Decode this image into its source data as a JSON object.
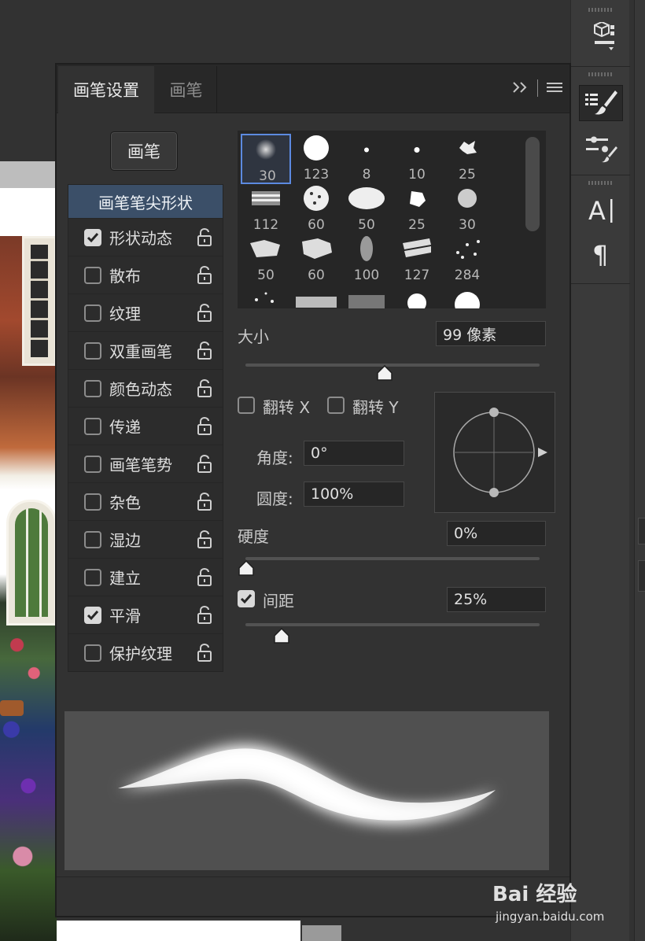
{
  "panel": {
    "tabs": [
      {
        "label": "画笔设置"
      },
      {
        "label": "画笔"
      }
    ],
    "brush_button_label": "画笔"
  },
  "settings_list": {
    "header": "画笔笔尖形状",
    "items": [
      {
        "label": "形状动态",
        "checked": true
      },
      {
        "label": "散布",
        "checked": false
      },
      {
        "label": "纹理",
        "checked": false
      },
      {
        "label": "双重画笔",
        "checked": false
      },
      {
        "label": "颜色动态",
        "checked": false
      },
      {
        "label": "传递",
        "checked": false
      },
      {
        "label": "画笔笔势",
        "checked": false
      },
      {
        "label": "杂色",
        "checked": false
      },
      {
        "label": "湿边",
        "checked": false
      },
      {
        "label": "建立",
        "checked": false
      },
      {
        "label": "平滑",
        "checked": true
      },
      {
        "label": "保护纹理",
        "checked": false
      }
    ]
  },
  "presets": {
    "sizes": [
      "30",
      "123",
      "8",
      "10",
      "25",
      "112",
      "60",
      "50",
      "25",
      "30",
      "50",
      "60",
      "100",
      "127",
      "284"
    ],
    "selected": "30"
  },
  "size": {
    "label": "大小",
    "value": "99 像素",
    "slider_fraction": 0.47
  },
  "flip": {
    "x_label": "翻转 X",
    "y_label": "翻转 Y",
    "x_checked": false,
    "y_checked": false
  },
  "angle": {
    "label": "角度:",
    "value": "0°"
  },
  "roundness": {
    "label": "圆度:",
    "value": "100%"
  },
  "hardness": {
    "label": "硬度",
    "value": "0%",
    "slider_fraction": 0.0
  },
  "spacing": {
    "label": "间距",
    "value": "25%",
    "checked": true,
    "slider_fraction": 0.12
  },
  "watermark": {
    "main": "Bai 经验",
    "sub": "jingyan.baidu.com"
  },
  "colors": {
    "accent": "#5c8ae0",
    "list_header": "#3b4f68"
  }
}
